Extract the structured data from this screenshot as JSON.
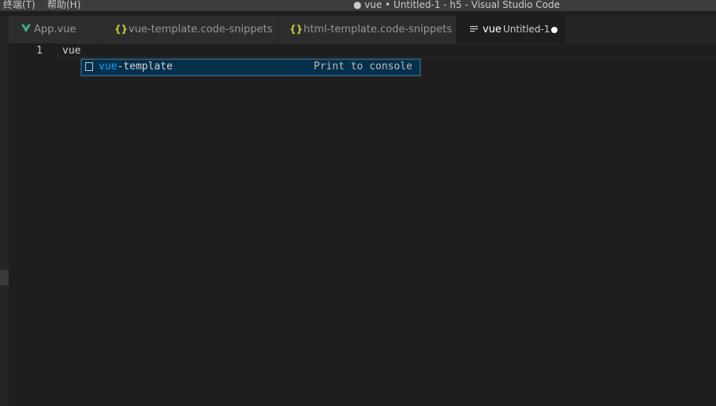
{
  "titlebar": {
    "menu": [
      {
        "label": "终端(T)"
      },
      {
        "label": "帮助(H)"
      }
    ],
    "window_title": "● vue • Untitled-1 - h5 - Visual Studio Code"
  },
  "tabs": [
    {
      "icon": "vue-icon",
      "label": "App.vue",
      "active": false
    },
    {
      "icon": "json-braces-icon",
      "label": "vue-template.code-snippets",
      "active": false
    },
    {
      "icon": "json-braces-icon",
      "label": "html-template.code-snippets",
      "active": false
    },
    {
      "icon": "text-lines-icon",
      "label": "vue",
      "description": "Untitled-1",
      "active": true,
      "dirty": true
    }
  ],
  "editor": {
    "lines": [
      {
        "number": "1",
        "text": "vue"
      }
    ]
  },
  "suggest": {
    "items": [
      {
        "icon": "snippet-icon",
        "match": "vue",
        "rest": "-template",
        "detail": "Print to console"
      }
    ]
  },
  "colors": {
    "accent_match": "#18a3ff",
    "vue_green": "#41b883",
    "json_yellow": "#cbcb41",
    "dirty_dot": "#ffffff"
  }
}
